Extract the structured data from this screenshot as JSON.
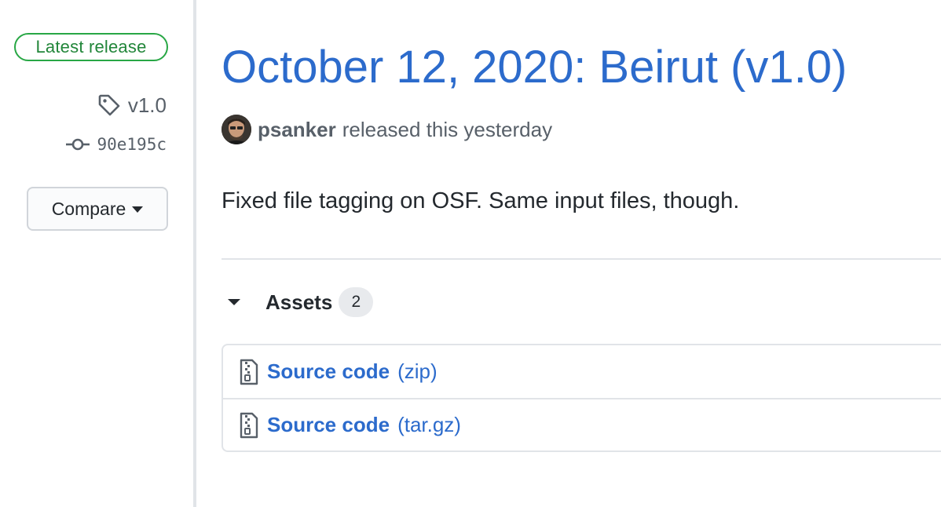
{
  "sidebar": {
    "latest_label": "Latest release",
    "tag": "v1.0",
    "commit": "90e195c",
    "compare_label": "Compare"
  },
  "release": {
    "title": "October 12, 2020: Beirut (v1.0)",
    "author": "psanker",
    "released_text": "released this yesterday",
    "description": "Fixed file tagging on OSF. Same input files, though."
  },
  "assets": {
    "title": "Assets",
    "count": "2",
    "items": [
      {
        "name": "Source code",
        "ext": "(zip)"
      },
      {
        "name": "Source code",
        "ext": "(tar.gz)"
      }
    ]
  },
  "colors": {
    "link": "#2c6bcc",
    "badge_green": "#28a745",
    "muted": "#586069"
  }
}
